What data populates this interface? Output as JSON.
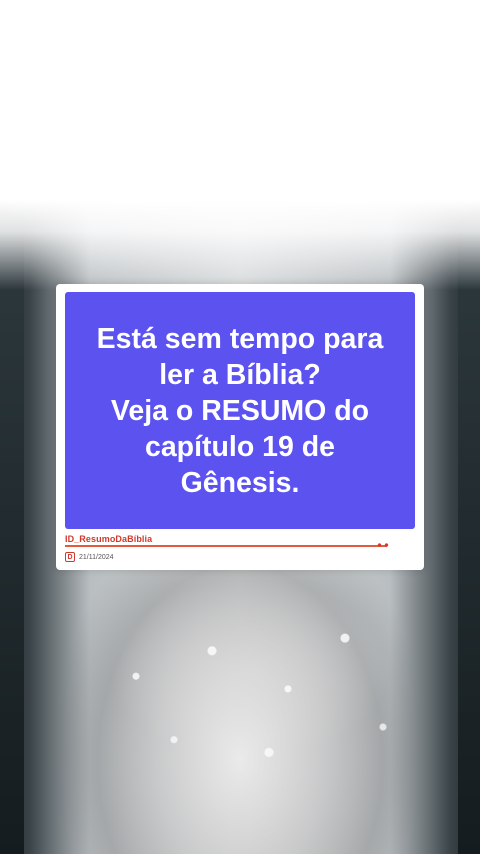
{
  "card": {
    "question": "Está sem tempo para\nler a Bíblia?\nVeja o RESUMO do\ncapítulo 19 de\nGênesis.",
    "handle": "ID_ResumoDaBíblia",
    "date": "21/11/2024",
    "date_icon_letter": "D"
  },
  "colors": {
    "question_bg": "#5b52f0",
    "handle_red": "#d0392b"
  }
}
